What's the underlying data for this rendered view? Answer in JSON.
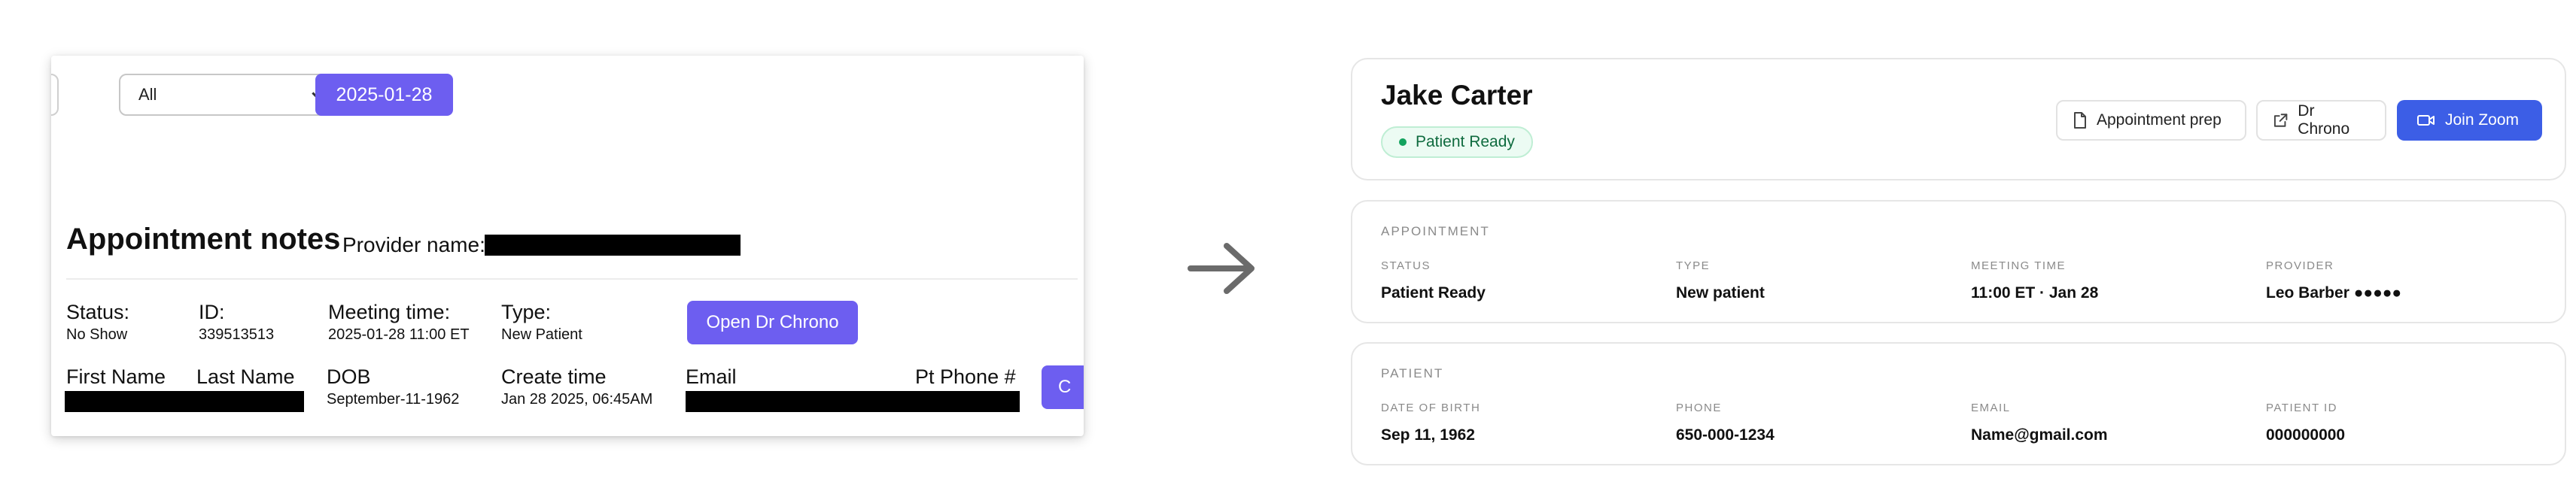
{
  "old_ui": {
    "filter_value": "All",
    "date_button": "2025-01-28",
    "title": "Appointment notes",
    "provider_label": "Provider name:",
    "status": {
      "label": "Status:",
      "value": "No Show"
    },
    "id": {
      "label": "ID:",
      "value": "339513513"
    },
    "meeting_time": {
      "label": "Meeting time:",
      "value": "2025-01-28 11:00 ET"
    },
    "type": {
      "label": "Type:",
      "value": "New Patient"
    },
    "open_button": "Open Dr Chrono",
    "columns": {
      "first_name": "First Name",
      "last_name": "Last Name",
      "dob": "DOB",
      "create_time": "Create time",
      "email": "Email",
      "phone": "Pt Phone #"
    },
    "row": {
      "dob": "September-11-1962",
      "create_time": "Jan 28 2025, 06:45AM"
    },
    "cut_button": "C"
  },
  "new_ui": {
    "patient_name": "Jake Carter",
    "status_badge": "Patient Ready",
    "buttons": {
      "appointment_prep": "Appointment prep",
      "dr_chrono": "Dr Chrono",
      "join_zoom": "Join Zoom"
    },
    "appointment": {
      "section_title": "APPOINTMENT",
      "status_label": "STATUS",
      "status_value": "Patient Ready",
      "type_label": "TYPE",
      "type_value": "New patient",
      "meeting_time_label": "MEETING TIME",
      "meeting_time_value": "11:00 ET · Jan 28",
      "provider_label": "PROVIDER",
      "provider_value": "Leo Barber ●●●●●"
    },
    "patient": {
      "section_title": "PATIENT",
      "dob_label": "DATE OF BIRTH",
      "dob_value": "Sep 11, 1962",
      "phone_label": "PHONE",
      "phone_value": "650-000-1234",
      "email_label": "EMAIL",
      "email_value": "Name@gmail.com",
      "id_label": "PATIENT ID",
      "id_value": "000000000"
    }
  },
  "colors": {
    "old_accent": "#6d5ef0",
    "new_accent": "#3c5ee6",
    "ready_green": "#13a35e"
  }
}
